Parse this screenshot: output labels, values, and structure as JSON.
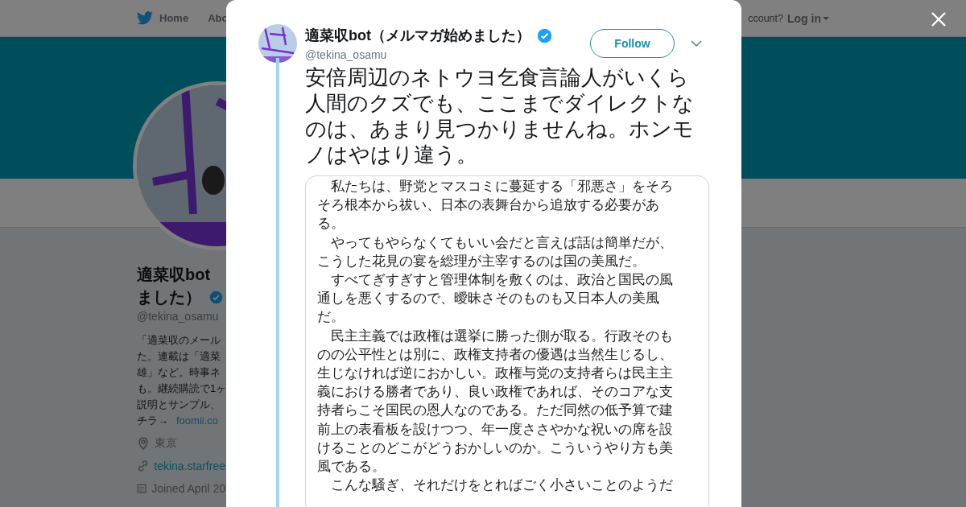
{
  "nav": {
    "items": [
      {
        "label": "Home",
        "kind": "home"
      },
      {
        "label": "Abo",
        "kind": "plain"
      }
    ],
    "account_prompt": "ccount?",
    "login": "Log in"
  },
  "profile": {
    "name_lines": [
      "適菜収bot",
      "ました）"
    ],
    "verified": true,
    "handle": "@tekina_osamu",
    "bio_lines": [
      "「適菜収のメール",
      "た。連載は「適菜",
      "雄」など。時事ネ",
      "も。継続購読で1ヶ",
      "説明とサンプル、"
    ],
    "bio_last": "チラ→",
    "bio_link": "foomii.co",
    "details": [
      {
        "kind": "location",
        "text": "東京",
        "link": false
      },
      {
        "kind": "link",
        "text": "tekina.starfree",
        "link": true
      },
      {
        "kind": "joined",
        "text": "Joined April 20",
        "link": false
      }
    ]
  },
  "tweet": {
    "name": "適菜収bot（メルマガ始めました）",
    "verified": true,
    "handle": "@tekina_osamu",
    "follow": "Follow",
    "text": "安倍周辺のネトウヨ乞食言論人がいくら人間のクズでも、ここまでダイレクトなのは、あまり見つかりませんね。ホンモノはやはり違う。",
    "document_lines": [
      "　私たちは、野党とマスコミに蔓延する「邪悪さ」をそろ",
      "そろ根本から祓い、日本の表舞台から追放する必要があ",
      "る。",
      "　やってもやらなくてもいい会だと言えば話は簡単だが、",
      "こうした花見の宴を総理が主宰するのは国の美風だ。",
      "　すべてぎすぎすと管理体制を敷くのは、政治と国民の風",
      "通しを悪くするので、曖昧さそのものも又日本人の美風",
      "だ。",
      "　民主主義では政権は選挙に勝った側が取る。行政そのも",
      "のの公平性とは別に、政権支持者の優遇は当然生じるし、",
      "生じなければ逆におかしい。政権与党の支持者らは民主主",
      "義における勝者であり、良い政権であれば、そのコアな支",
      "持者らこそ国民の恩人なのである。ただ同然の低予算で建",
      "前上の表看板を設けつつ、年一度ささやかな祝いの席を設",
      "けることのどこがどうおかしいのか。こういうやり方も美",
      "風である。",
      "　こんな騒ぎ、それだけをとればごく小さいことのようだ"
    ]
  }
}
